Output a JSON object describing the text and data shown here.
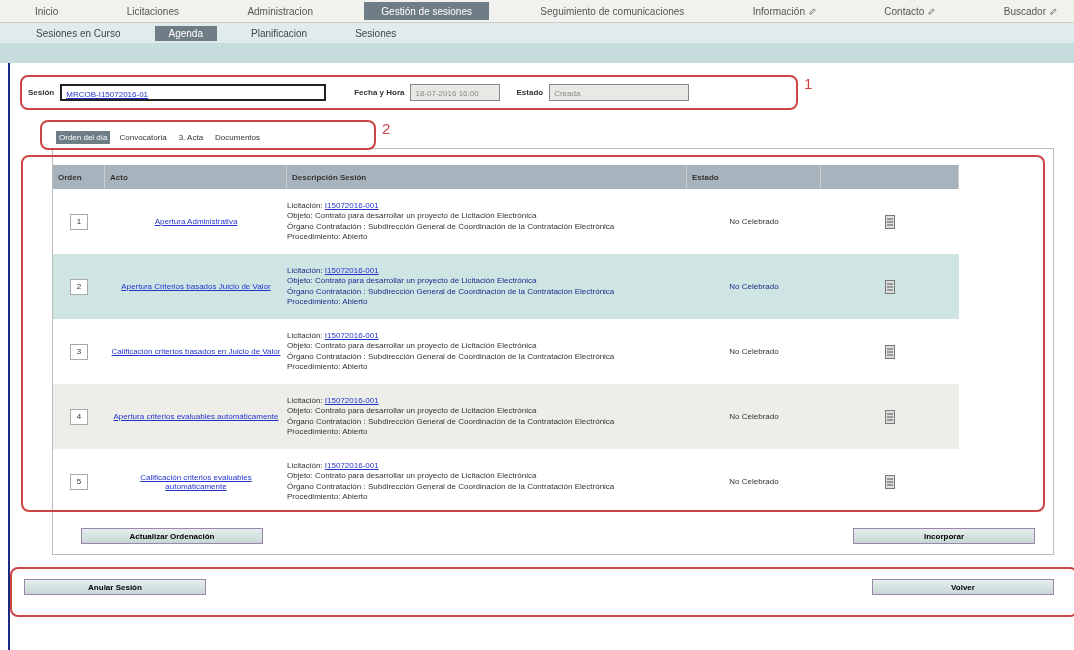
{
  "nav": [
    {
      "label": "Inicio",
      "selected": false,
      "icon": false
    },
    {
      "label": "Licitaciones",
      "selected": false,
      "icon": false
    },
    {
      "label": "Administracion",
      "selected": false,
      "icon": false
    },
    {
      "label": "Gestión de sesiones",
      "selected": true,
      "icon": false
    },
    {
      "label": "Seguimiento de comunicaciones",
      "selected": false,
      "icon": false
    },
    {
      "label": "Información",
      "selected": false,
      "icon": true
    },
    {
      "label": "Contacto",
      "selected": false,
      "icon": true
    },
    {
      "label": "Buscador",
      "selected": false,
      "icon": true
    }
  ],
  "subnav": [
    {
      "label": "Sesiones en Curso",
      "selected": false
    },
    {
      "label": "Agenda",
      "selected": true
    },
    {
      "label": "Planificacion",
      "selected": false
    },
    {
      "label": "Sesiones",
      "selected": false
    }
  ],
  "session": {
    "label": "Sesión",
    "value": "MRCOB-I15072016-01",
    "date_label": "Fecha y Hora",
    "date": "18-07-2016 16:00",
    "state_label": "Estado",
    "state": "Creada"
  },
  "tabs": [
    {
      "label": "Orden del día",
      "selected": true
    },
    {
      "label": "Convocatoria",
      "selected": false
    },
    {
      "label": "3. Acta",
      "selected": false
    },
    {
      "label": "Documentos",
      "selected": false
    }
  ],
  "table": {
    "columns": [
      "Orden",
      "Acto",
      "Descripción Sesión",
      "Estado"
    ],
    "rows": [
      {
        "order": "1",
        "act": "Apertura Administrativa",
        "selected": false,
        "licitacion_label": "Licitación:",
        "licitacion": "I15072016-001",
        "lines": [
          "Objeto: Contrato para desarrollar un proyecto de Licitación Electrónica",
          "Órgano Contratación : Subdirección General de Coordinación de la Contratación Electrónica",
          "Procedimiento: Abierto"
        ],
        "state": "No Celebrado"
      },
      {
        "order": "2",
        "act": "Apertura Criterios basados Juicio de Valor",
        "selected": true,
        "licitacion_label": "Licitación:",
        "licitacion": "I15072016-001",
        "lines": [
          "Objeto: Contrato para desarrollar un proyecto de Licitación Electrónica",
          "Órgano Contratación : Subdirección General de Coordinación de la Contratación Electrónica",
          "Procedimiento: Abierto"
        ],
        "state": "No Celebrado"
      },
      {
        "order": "3",
        "act": "Calificación criterios basados en Juicio de Valor",
        "selected": false,
        "licitacion_label": "Licitación:",
        "licitacion": "I15072016-001",
        "lines": [
          "Objeto: Contrato para desarrollar un proyecto de Licitación Electrónica",
          "Órgano Contratación : Subdirección General de Coordinación de la Contratación Electrónica",
          "Procedimiento: Abierto"
        ],
        "state": "No Celebrado"
      },
      {
        "order": "4",
        "act": "Apertura criterios evaluables automáticamente",
        "selected": false,
        "licitacion_label": "Licitación:",
        "licitacion": "I15072016-001",
        "lines": [
          "Objeto: Contrato para desarrollar un proyecto de Licitación Electrónica",
          "Órgano Contratación : Subdirección General de Coordinación de la Contratación Electrónica",
          "Procedimiento: Abierto"
        ],
        "state": "No Celebrado"
      },
      {
        "order": "5",
        "act": "Calificación criterios evaluables automáticamente",
        "selected": false,
        "licitacion_label": "Licitación:",
        "licitacion": "I15072016-001",
        "lines": [
          "Objeto: Contrato para desarrollar un proyecto de Licitación Electrónica",
          "Órgano Contratación : Subdirección General de Coordinación de la Contratación Electrónica",
          "Procedimiento: Abierto"
        ],
        "state": "No Celebrado"
      }
    ]
  },
  "table_buttons": [
    "Actualizar Ordenación",
    "Incorporar"
  ],
  "footer_buttons": [
    "Anular Sesión",
    "Volver"
  ],
  "annotations": [
    "1",
    "2"
  ]
}
